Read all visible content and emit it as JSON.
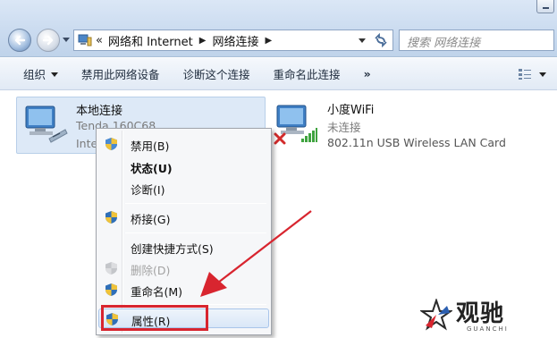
{
  "address_bar": {
    "chevron": "«",
    "crumbs": [
      "网络和 Internet",
      "网络连接"
    ],
    "search_placeholder": "搜索 网络连接"
  },
  "command_bar": {
    "organize": "组织",
    "items": [
      "禁用此网络设备",
      "诊断这个连接",
      "重命名此连接"
    ],
    "more": "»"
  },
  "connections": [
    {
      "name": "本地连接",
      "detail": "Tenda 160C68",
      "adapter_partial": "Inte"
    },
    {
      "name": "小度WiFi",
      "status": "未连接",
      "adapter": "802.11n USB Wireless LAN Card"
    }
  ],
  "context_menu": {
    "items": [
      {
        "label": "禁用(B)",
        "icon": "shield-icon",
        "style": "normal"
      },
      {
        "label": "状态(U)",
        "icon": "",
        "style": "bold"
      },
      {
        "label": "诊断(I)",
        "icon": "",
        "style": "normal"
      },
      {
        "label": "桥接(G)",
        "icon": "shield-icon",
        "style": "normal"
      },
      {
        "label": "创建快捷方式(S)",
        "icon": "",
        "style": "normal"
      },
      {
        "label": "删除(D)",
        "icon": "shield-icon",
        "style": "disabled"
      },
      {
        "label": "重命名(M)",
        "icon": "shield-icon",
        "style": "normal"
      },
      {
        "label": "属性(R)",
        "icon": "shield-icon",
        "style": "highlighted"
      }
    ]
  },
  "annotation": {
    "highlight_color": "#d8252f",
    "arrow_color": "#d8252f"
  },
  "watermark": {
    "text": "观驰",
    "sub": "GUANCHI"
  }
}
